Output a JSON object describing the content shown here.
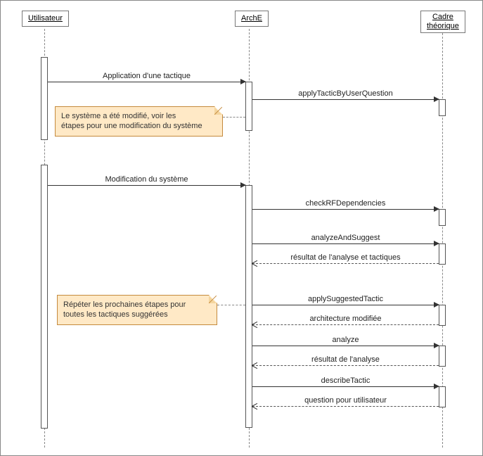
{
  "lifelines": {
    "user": "Utilisateur",
    "arche": "ArchE",
    "framework": "Cadre\nthéorique"
  },
  "messages": {
    "applyTactic": "Application d'une tactique",
    "applyTacticByUserQuestion": "applyTacticByUserQuestion",
    "modSystem": "Modification du système",
    "checkRF": "checkRFDependencies",
    "analyzeSuggest": "analyzeAndSuggest",
    "resultTactics": "résultat de l'analyse et tactiques",
    "applySuggested": "applySuggestedTactic",
    "archModified": "architecture modifiée",
    "analyze": "analyze",
    "resultAnalysis": "résultat de l'analyse",
    "describeTactic": "describeTactic",
    "questionUser": "question pour utilisateur"
  },
  "notes": {
    "note1": "Le système a été modifié, voir les\nétapes pour une modification du système",
    "note2": "Répéter les prochaines étapes pour\ntoutes les tactiques suggérées"
  },
  "colors": {
    "notebg": "#ffe9c6",
    "noteborder": "#c58a3d"
  }
}
